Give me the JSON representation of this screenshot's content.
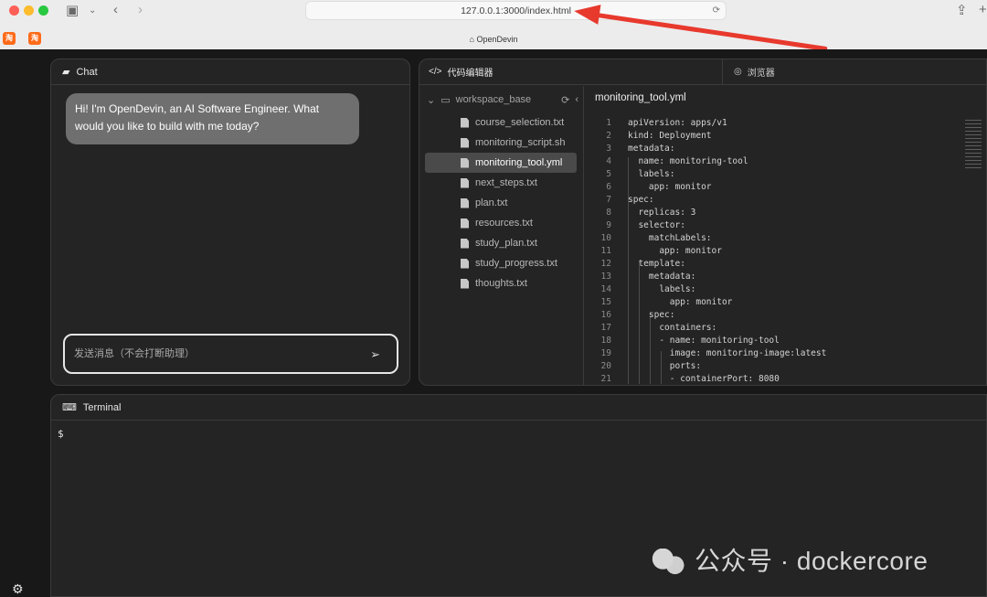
{
  "browser": {
    "url": "127.0.0.1:3000/index.html",
    "tab_title": "OpenDevin",
    "favicon": "淘"
  },
  "chat": {
    "title": "Chat",
    "message": "Hi! I'm OpenDevin, an AI Software Engineer. What would you like to build with me today?",
    "input_placeholder": "发送消息（不会打断助理）"
  },
  "editor": {
    "tab_code": "代码编辑器",
    "tab_browser": "浏览器",
    "workspace": "workspace_base",
    "open_file": "monitoring_tool.yml",
    "files": [
      "course_selection.txt",
      "monitoring_script.sh",
      "monitoring_tool.yml",
      "next_steps.txt",
      "plan.txt",
      "resources.txt",
      "study_plan.txt",
      "study_progress.txt",
      "thoughts.txt"
    ],
    "line_numbers": [
      "1",
      "2",
      "3",
      "4",
      "5",
      "6",
      "7",
      "8",
      "9",
      "10",
      "11",
      "12",
      "13",
      "14",
      "15",
      "16",
      "17",
      "18",
      "19",
      "20",
      "21"
    ],
    "code_lines": [
      "apiVersion: apps/v1",
      "kind: Deployment",
      "metadata:",
      "  name: monitoring-tool",
      "  labels:",
      "    app: monitor",
      "spec:",
      "  replicas: 3",
      "  selector:",
      "    matchLabels:",
      "      app: monitor",
      "  template:",
      "    metadata:",
      "      labels:",
      "        app: monitor",
      "    spec:",
      "      containers:",
      "      - name: monitoring-tool",
      "        image: monitoring-image:latest",
      "        ports:",
      "        - containerPort: 8080"
    ]
  },
  "terminal": {
    "title": "Terminal",
    "prompt": "$"
  },
  "watermark": "公众号 · dockercore",
  "colors": {
    "arrow": "#e8392d",
    "panel": "#242424",
    "border": "#3b3b3b"
  }
}
